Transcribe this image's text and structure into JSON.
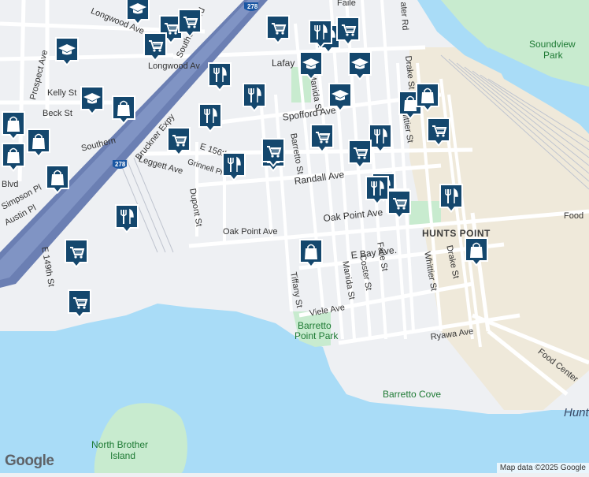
{
  "map": {
    "colors": {
      "water": "#a9dcf7",
      "land": "#eef0f3",
      "park": "#c8ebcf",
      "industrial": "#efe9da",
      "road": "#ffffff",
      "highway": "#8094c4",
      "highway_edge": "#6b7fb3",
      "rail": "#bfc4cf",
      "pin": "#14476d",
      "pin_icon": "#ffffff"
    },
    "labels": {
      "longwood_ave_top": "Longwood Ave",
      "longwood_ave": "Longwood Av",
      "southern_blvd": "Southern Blvd",
      "southern": "Southern",
      "bruckner_expy": "Bruckner Expy",
      "prospect_ave": "Prospect Ave",
      "kelly_st": "Kelly St",
      "beck_st": "Beck St",
      "leggett_ave": "Leggett Ave",
      "e156th": "E 156th",
      "grinnell_pl": "Grinnell Pl",
      "dupont_st": "Dupont St",
      "simpson_pl": "Simpson Pl",
      "austin_pl": "Austin Pl",
      "e149th_st": "E 149th St",
      "oak_point_ave_w": "Oak Point Ave",
      "oak_point_ave_e": "Oak Point Ave",
      "randall_ave": "Randall Ave",
      "spofford_ave": "Spofford Ave",
      "lafayette": "Lafay",
      "barretto_st": "Barretto St",
      "manida_st_n": "Manida St",
      "manida_st_s": "Manida St",
      "coster_st": "Coster St",
      "faile_st": "Faile St",
      "whittier_st_n": "Whittier St",
      "whittier_st_s": "Whittier St",
      "drake_st_n": "Drake St",
      "drake_st_s": "Drake St",
      "tiffany_st": "Tiffany St",
      "viele_ave": "Viele Ave",
      "e_bay_ave": "E Bay Ave.",
      "ryawa_ave": "Ryawa Ave",
      "hunts_point": "HUNTS POINT",
      "hunts_point_water": "Hunt",
      "food_center": "Food Center",
      "food_top": "Food",
      "barretto_park_1": "Barretto",
      "barretto_park_2": "Point Park",
      "barretto_cove": "Barretto Cove",
      "north_brother_1": "North Brother",
      "north_brother_2": "Island",
      "soundview_1": "Soundview",
      "soundview_2": "Park",
      "water_rd": "ater Rd",
      "highway_shield": "278",
      "highway_shield_2": "278",
      "blvd": "Blvd",
      "falle_top": "Faile"
    },
    "pins": [
      {
        "name": "school",
        "icon": "graduation-cap"
      },
      {
        "name": "grocery",
        "icon": "shopping-cart"
      },
      {
        "name": "grocery",
        "icon": "shopping-cart"
      },
      {
        "name": "school",
        "icon": "graduation-cap"
      },
      {
        "name": "grocery",
        "icon": "shopping-cart"
      },
      {
        "name": "grocery",
        "icon": "shopping-cart"
      },
      {
        "name": "restaurant",
        "icon": "fork-knife"
      },
      {
        "name": "restaurant",
        "icon": "fork-knife"
      },
      {
        "name": "grocery",
        "icon": "shopping-cart"
      },
      {
        "name": "school",
        "icon": "graduation-cap"
      },
      {
        "name": "school",
        "icon": "graduation-cap"
      },
      {
        "name": "restaurant",
        "icon": "fork-knife"
      },
      {
        "name": "restaurant",
        "icon": "fork-knife"
      },
      {
        "name": "school",
        "icon": "graduation-cap"
      },
      {
        "name": "store",
        "icon": "shopping-bag"
      },
      {
        "name": "school",
        "icon": "graduation-cap"
      },
      {
        "name": "restaurant",
        "icon": "fork-knife"
      },
      {
        "name": "grocery",
        "icon": "shopping-cart"
      },
      {
        "name": "store",
        "icon": "shopping-bag"
      },
      {
        "name": "store",
        "icon": "shopping-bag"
      },
      {
        "name": "grocery",
        "icon": "shopping-cart"
      },
      {
        "name": "restaurant",
        "icon": "fork-knife"
      },
      {
        "name": "grocery",
        "icon": "shopping-cart"
      },
      {
        "name": "store",
        "icon": "shopping-bag"
      },
      {
        "name": "restaurant",
        "icon": "fork-knife"
      },
      {
        "name": "store",
        "icon": "shopping-bag"
      },
      {
        "name": "store",
        "icon": "shopping-bag"
      },
      {
        "name": "restaurant",
        "icon": "fork-knife"
      },
      {
        "name": "grocery",
        "icon": "shopping-cart"
      },
      {
        "name": "restaurant",
        "icon": "fork-knife"
      },
      {
        "name": "restaurant",
        "icon": "fork-knife"
      },
      {
        "name": "grocery",
        "icon": "shopping-cart"
      },
      {
        "name": "store",
        "icon": "shopping-bag"
      },
      {
        "name": "store",
        "icon": "shopping-bag"
      },
      {
        "name": "restaurant",
        "icon": "fork-knife"
      },
      {
        "name": "grocery",
        "icon": "shopping-cart"
      },
      {
        "name": "store",
        "icon": "shopping-bag"
      },
      {
        "name": "grocery",
        "icon": "shopping-cart"
      },
      {
        "name": "store",
        "icon": "shopping-bag"
      },
      {
        "name": "grocery",
        "icon": "shopping-cart"
      },
      {
        "name": "grocery",
        "icon": "shopping-cart"
      }
    ],
    "attribution": "Map data ©2025 Google",
    "logo": "Google"
  }
}
